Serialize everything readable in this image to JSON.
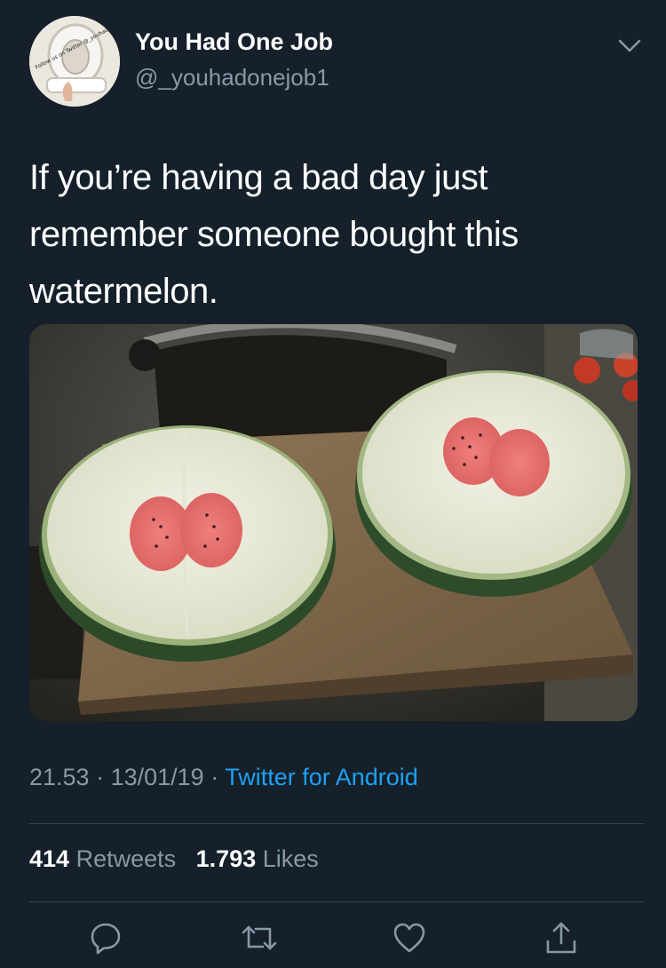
{
  "author": {
    "display_name": "You Had One Job",
    "handle": "@_youhadonejob1",
    "avatar_icon": "toilet-seat-avatar",
    "avatar_watermark": "Follow us on Twitter @_youhadonejob1"
  },
  "tweet": {
    "text_lines": [
      "If you’re having a bad day just",
      "remember someone bought this",
      "watermelon."
    ]
  },
  "media": {
    "icon": "watermelon-photo"
  },
  "meta": {
    "time": "21.53",
    "sep1": " · ",
    "date": "13/01/19",
    "sep2": " · ",
    "source": "Twitter for Android"
  },
  "stats": {
    "retweets_count": "414",
    "retweets_label": "Retweets",
    "likes_count": "1.793",
    "likes_label": "Likes"
  },
  "actions": {
    "reply_icon": "reply-icon",
    "retweet_icon": "retweet-icon",
    "like_icon": "heart-icon",
    "share_icon": "share-icon"
  },
  "colors": {
    "background": "#15202b",
    "text": "#ffffff",
    "secondary": "#8899a6",
    "accent": "#1da1f2",
    "divider": "#38444d"
  }
}
